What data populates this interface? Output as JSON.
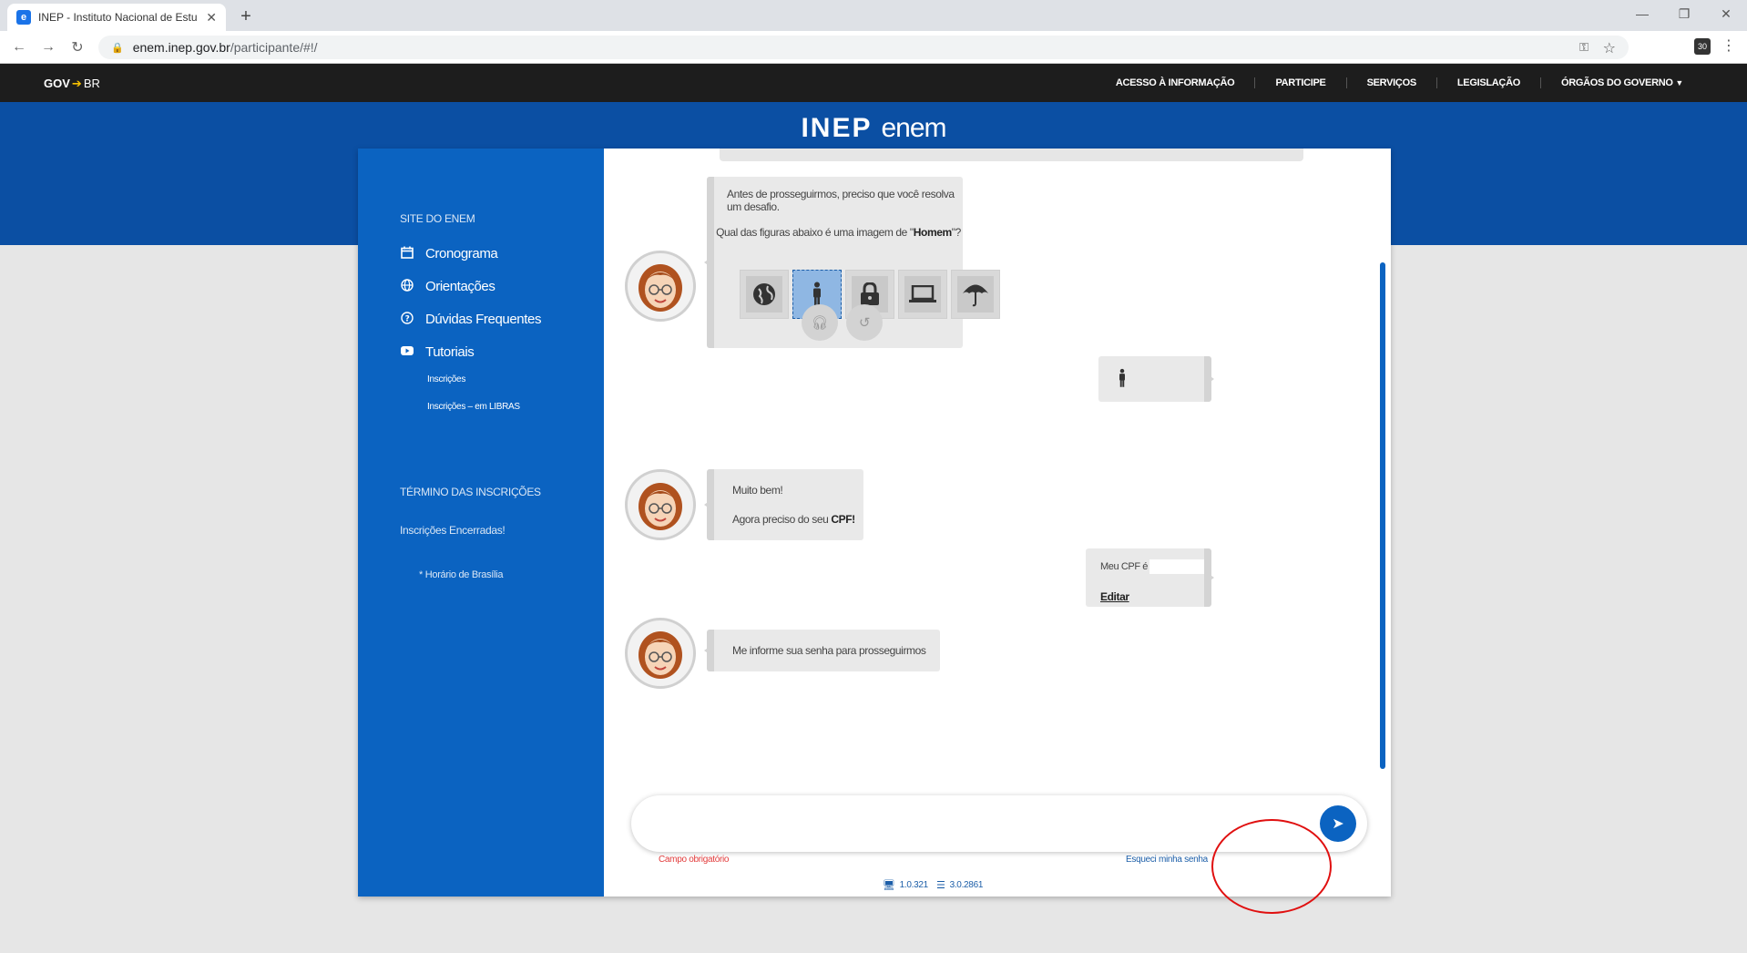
{
  "browser": {
    "tab_title": "INEP - Instituto Nacional de Estu",
    "tab_favicon": "e",
    "url_host": "enem.inep.gov.br",
    "url_path": "/participante/#!/",
    "extension_label": "30"
  },
  "gov": {
    "logo_gov": "GOV",
    "logo_br": "BR",
    "links": [
      "ACESSO À INFORMAÇÃO",
      "PARTICIPE",
      "SERVIÇOS",
      "LEGISLAÇÃO",
      "ÓRGÃOS DO GOVERNO"
    ]
  },
  "brand": {
    "inep": "INEP",
    "enem": "enem"
  },
  "sidebar": {
    "section_title": "SITE DO ENEM",
    "items": [
      {
        "label": "Cronograma",
        "icon": "calendar-icon"
      },
      {
        "label": "Orientações",
        "icon": "globe-icon"
      },
      {
        "label": "Dúvidas Frequentes",
        "icon": "question-icon"
      },
      {
        "label": "Tutoriais",
        "icon": "youtube-icon"
      }
    ],
    "subitems": [
      "Inscrições",
      "Inscrições – em LIBRAS"
    ],
    "term_title": "TÉRMINO DAS INSCRIÇÕES",
    "term_text": "Inscrições Encerradas!",
    "timezone_note": "* Horário de Brasília"
  },
  "chat": {
    "challenge_intro": "Antes de prosseguirmos, preciso que você resolva um desafio.",
    "challenge_q_pre": "Qual das figuras abaixo é uma imagem de \"",
    "challenge_q_word": "Homem",
    "challenge_q_post": "\"?",
    "challenge_icons": [
      "globe-icon",
      "man-icon",
      "lock-icon",
      "laptop-icon",
      "umbrella-icon"
    ],
    "selected_icon": "man-icon",
    "msg_good": "Muito bem!",
    "msg_cpf_pre": "Agora preciso do seu ",
    "msg_cpf_word": "CPF!",
    "cpf_label": "Meu CPF é",
    "edit_label": "Editar",
    "msg_password": "Me informe sua senha para prosseguirmos"
  },
  "input": {
    "value": "",
    "required": "Campo obrigatório",
    "forgot": "Esqueci minha senha"
  },
  "versions": {
    "front": "1.0.321",
    "back": "3.0.2861"
  },
  "colors": {
    "gov_bar": "#1d1d1d",
    "header_blue": "#0b4fa3",
    "sidebar_blue": "#0b63c1",
    "annotation": "#e01010"
  }
}
